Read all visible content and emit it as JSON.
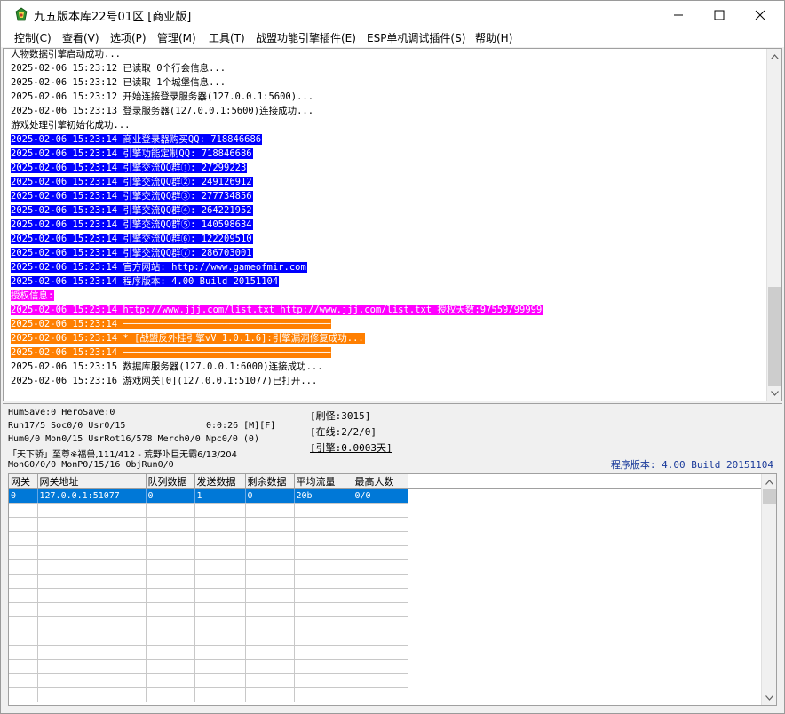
{
  "window": {
    "title": "九五版本库22号01区 [商业版]",
    "controls": {
      "minimize": "—",
      "maximize": "☐",
      "close": "✕"
    }
  },
  "menu": [
    {
      "label": "控制(C)"
    },
    {
      "label": "查看(V)"
    },
    {
      "label": "选项(P)"
    },
    {
      "label": "管理(M)"
    },
    {
      "label": "工具(T)"
    },
    {
      "label": "战盟功能引擎插件(E)"
    },
    {
      "label": "ESP单机调试插件(S)"
    },
    {
      "label": "帮助(H)"
    }
  ],
  "log": [
    {
      "text": "人物数据引擎启动成功...",
      "style": "normal"
    },
    {
      "text": "2025-02-06 15:23:12 已读取 0个行会信息...",
      "style": "normal"
    },
    {
      "text": "2025-02-06 15:23:12 已读取 1个城堡信息...",
      "style": "normal"
    },
    {
      "text": "2025-02-06 15:23:12 开始连接登录服务器(127.0.0.1:5600)...",
      "style": "normal"
    },
    {
      "text": "2025-02-06 15:23:13 登录服务器(127.0.0.1:5600)连接成功...",
      "style": "normal"
    },
    {
      "text": "游戏处理引擎初始化成功...",
      "style": "normal"
    },
    {
      "text": "2025-02-06 15:23:14 商业登录器购买QQ: 718846686",
      "style": "blue"
    },
    {
      "text": "2025-02-06 15:23:14 引擎功能定制QQ: 718846686",
      "style": "blue"
    },
    {
      "text": "2025-02-06 15:23:14 引擎交流QQ群①: 27299223",
      "style": "blue"
    },
    {
      "text": "2025-02-06 15:23:14 引擎交流QQ群②: 249126912",
      "style": "blue"
    },
    {
      "text": "2025-02-06 15:23:14 引擎交流QQ群③: 277734856",
      "style": "blue"
    },
    {
      "text": "2025-02-06 15:23:14 引擎交流QQ群④: 264221952",
      "style": "blue"
    },
    {
      "text": "2025-02-06 15:23:14 引擎交流QQ群⑤: 140598634",
      "style": "blue"
    },
    {
      "text": "2025-02-06 15:23:14 引擎交流QQ群⑥: 122209510",
      "style": "blue"
    },
    {
      "text": "2025-02-06 15:23:14 引擎交流QQ群⑦: 286703001",
      "style": "blue"
    },
    {
      "text": "2025-02-06 15:23:14 官方网站: http://www.gameofmir.com",
      "style": "blue"
    },
    {
      "text": "2025-02-06 15:23:14 程序版本: 4.00 Build 20151104",
      "style": "blue"
    },
    {
      "text": "授权信息:",
      "style": "magenta"
    },
    {
      "text": "2025-02-06 15:23:14 http://www.jjj.com/list.txt http://www.jjj.com/list.txt 授权天数:97559/99999",
      "style": "magenta"
    },
    {
      "text": "2025-02-06 15:23:14 ─────────────────────────────────────",
      "style": "orange"
    },
    {
      "text": "2025-02-06 15:23:14 * [战盟反外挂引擎vV 1.0.1.6]:引擎漏洞修复成功...",
      "style": "orange"
    },
    {
      "text": "2025-02-06 15:23:14 ─────────────────────────────────────",
      "style": "orange"
    },
    {
      "text": "2025-02-06 15:23:15 数据库服务器(127.0.0.1:6000)连接成功...",
      "style": "normal"
    },
    {
      "text": "2025-02-06 15:23:16 游戏网关[0](127.0.0.1:51077)已打开...",
      "style": "normal"
    }
  ],
  "status": {
    "line1": "HumSave:0 HeroSave:0",
    "line2_left": "Run17/5 Soc0/0 Usr0/15",
    "line2_time": "0:0:26 [M][F]",
    "line3": "Hum0/0 Mon0/15 UsrRot16/578 Merch0/0 Npc0/0 (0)",
    "line4": "「天下骄」至尊※福兽,111/412 - 荒野卟巨无霸6/13/204",
    "line5": "MonG0/0/0 MonP0/15/16 ObjRun0/0",
    "refresh": "[刷怪:3015]",
    "online": "[在线:2/2/0]",
    "engine": "[引擎:0.0003天]",
    "version": "程序版本: 4.00 Build 20151104"
  },
  "grid": {
    "columns": [
      "网关",
      "网关地址",
      "队列数据",
      "发送数据",
      "剩余数据",
      "平均流量",
      "最高人数"
    ],
    "rows": [
      [
        "0",
        "127.0.0.1:51077",
        "0",
        "1",
        "0",
        "20b",
        "0/0"
      ]
    ]
  },
  "colors": {
    "highlight_blue": "#0000ff",
    "highlight_magenta": "#ff00ff",
    "highlight_orange": "#ff7f00",
    "selected_row": "#0078d7",
    "version_text": "#1a3a9a"
  }
}
